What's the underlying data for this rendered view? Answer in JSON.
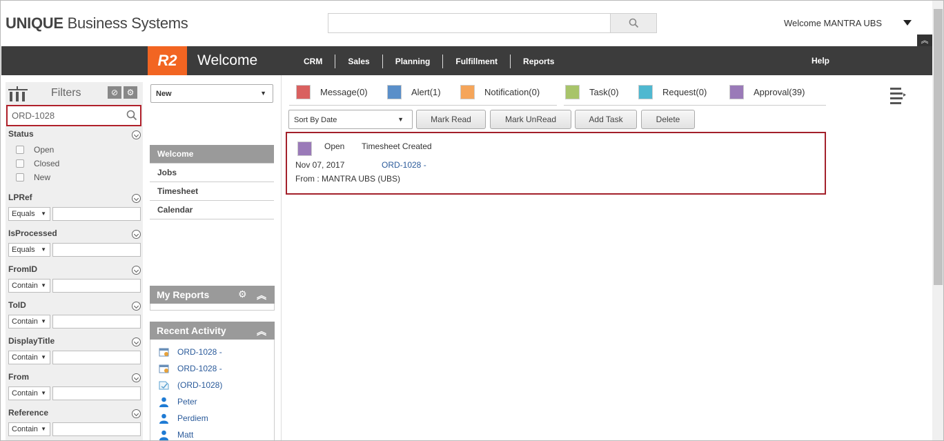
{
  "header": {
    "logo_bold": "UNIQUE",
    "logo_rest": " Business Systems",
    "search_value": "",
    "search_icon": "magnifier-icon",
    "welcome_text": "Welcome MANTRA UBS"
  },
  "nav": {
    "badge": "R2",
    "title": "Welcome",
    "items": [
      "CRM",
      "Sales",
      "Planning",
      "Fulfillment",
      "Reports"
    ],
    "help": "Help"
  },
  "filters": {
    "title": "Filters",
    "search_value": "ORD-1028",
    "status_label": "Status",
    "status_options": [
      "Open",
      "Closed",
      "New"
    ],
    "groups": [
      {
        "label": "LPRef",
        "op": "Equals"
      },
      {
        "label": "IsProcessed",
        "op": "Equals"
      },
      {
        "label": "FromID",
        "op": "Contain"
      },
      {
        "label": "ToID",
        "op": "Contain"
      },
      {
        "label": "DisplayTitle",
        "op": "Contain"
      },
      {
        "label": "From",
        "op": "Contain"
      },
      {
        "label": "Reference",
        "op": "Contain"
      }
    ]
  },
  "middle": {
    "new_select": "New",
    "menu": [
      "Welcome",
      "Jobs",
      "Timesheet",
      "Calendar"
    ],
    "my_reports": "My Reports",
    "recent_activity": "Recent Activity",
    "recent_items": [
      {
        "icon": "calendar-icon",
        "text": "ORD-1028 -"
      },
      {
        "icon": "calendar-icon",
        "text": "ORD-1028 -"
      },
      {
        "icon": "document-icon",
        "text": "(ORD-1028)"
      },
      {
        "icon": "person-icon",
        "text": "Peter"
      },
      {
        "icon": "person-icon",
        "text": "Perdiem"
      },
      {
        "icon": "person-icon",
        "text": "Matt"
      }
    ]
  },
  "categories": [
    {
      "label": "Message(0)",
      "color": "#d9605f"
    },
    {
      "label": "Alert(1)",
      "color": "#5a8fc9"
    },
    {
      "label": "Notification(0)",
      "color": "#f5a55a"
    },
    {
      "label": "Task(0)",
      "color": "#a8c46a"
    },
    {
      "label": "Request(0)",
      "color": "#4fb8d0"
    },
    {
      "label": "Approval(39)",
      "color": "#9a7ab8"
    }
  ],
  "toolbar": {
    "sort": "Sort By Date",
    "mark_read": "Mark Read",
    "mark_unread": "Mark UnRead",
    "add_task": "Add Task",
    "delete": "Delete"
  },
  "message": {
    "status": "Open",
    "type": "Timesheet Created",
    "date": "Nov 07, 2017",
    "link": "ORD-1028 -",
    "from": "From : MANTRA UBS (UBS)",
    "color": "#9a7ab8"
  }
}
